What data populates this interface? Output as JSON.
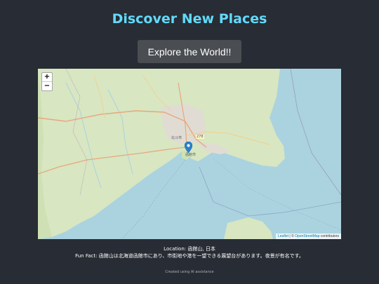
{
  "header": {
    "title": "Discover New Places",
    "explore_button_label": "Explore the World!!"
  },
  "map": {
    "zoom_in_label": "+",
    "zoom_out_label": "−",
    "attribution_leaflet": "Leaflet",
    "attribution_separator": " | © ",
    "attribution_osm": "OpenStreetMap",
    "attribution_contributors": " contributors",
    "labels": {
      "hokuto": "北斗市",
      "hakodate": "函館市",
      "route": "278"
    },
    "marker_icon": "map-pin-icon",
    "colors": {
      "water": "#aad3df",
      "land": "#d8e6c2",
      "marker": "#2a81cb"
    }
  },
  "info": {
    "location_label": "Location:",
    "location_value": "函館山, 日本",
    "fun_fact_label": "Fun Fact:",
    "fun_fact_value": "函館山は北海道函館市にあり、市街地や港を一望できる展望台があります。夜景が有名です。"
  },
  "footer": {
    "text": "Created using AI assistance"
  }
}
